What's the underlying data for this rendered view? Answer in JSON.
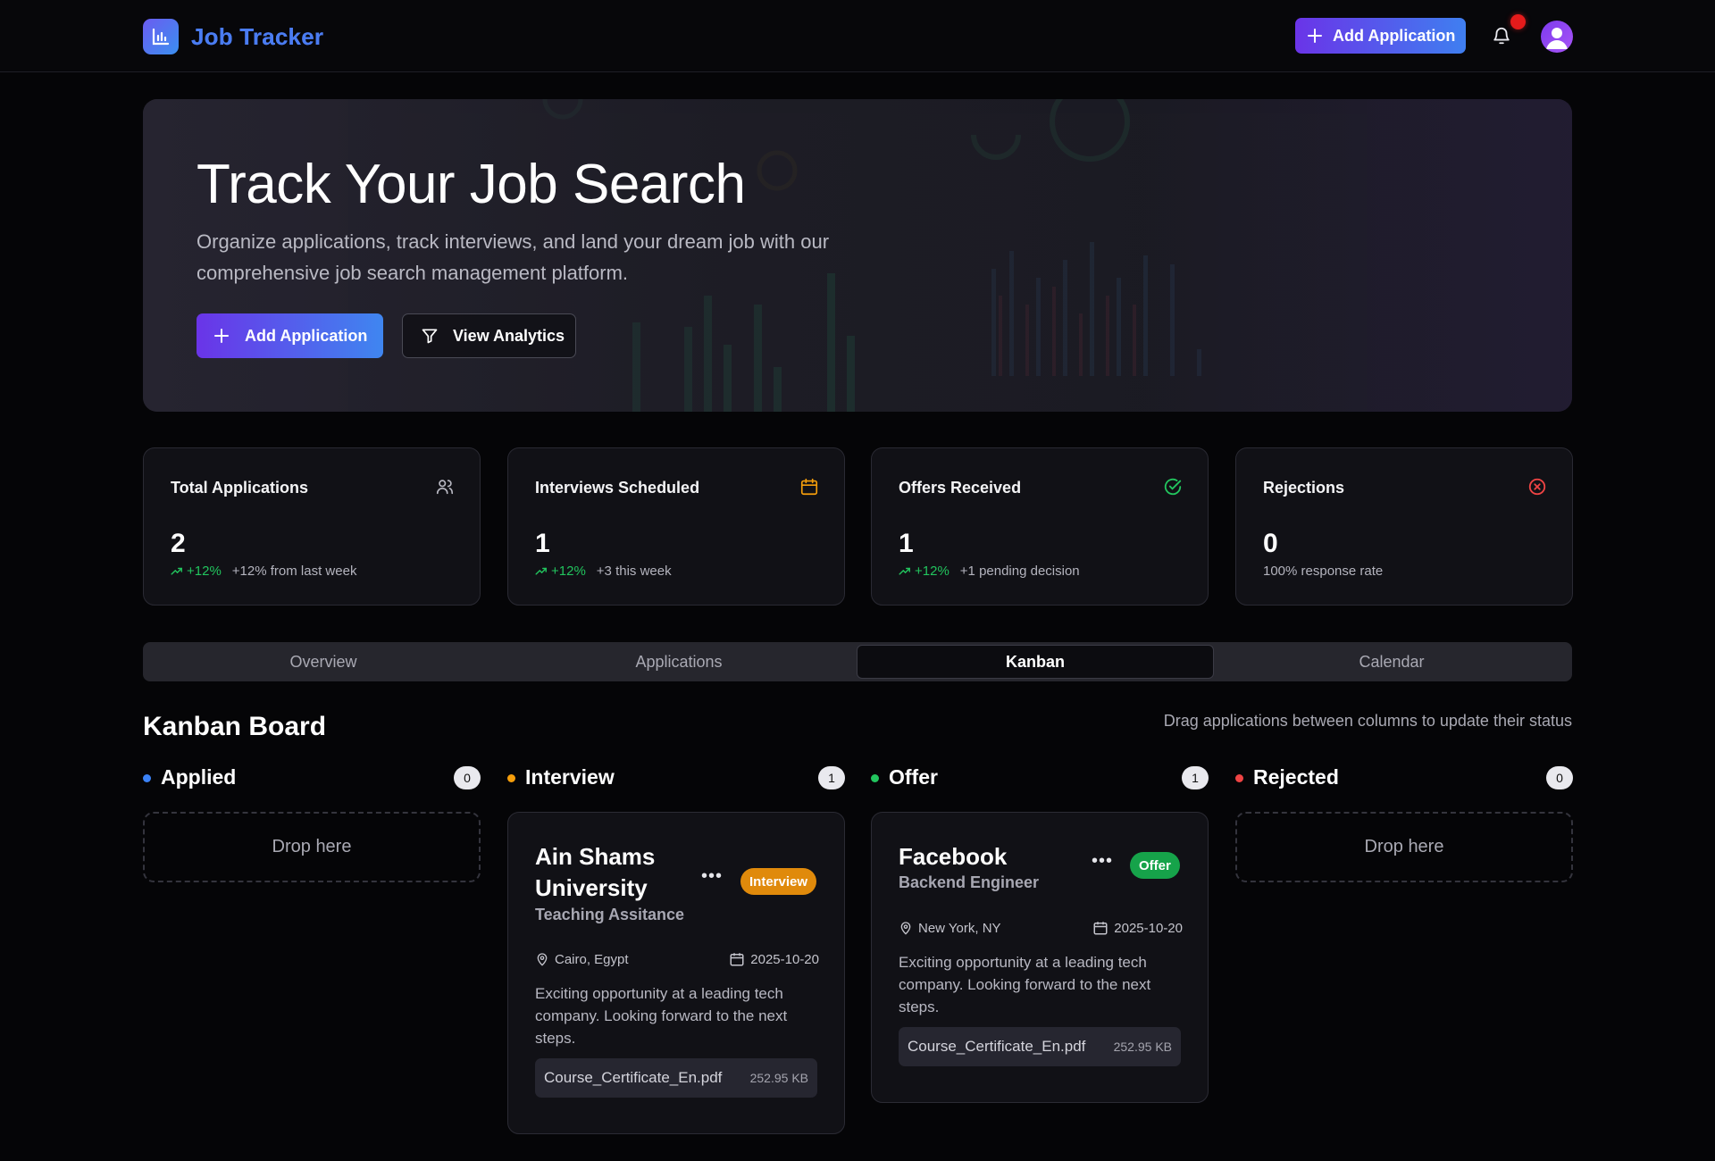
{
  "header": {
    "app_name": "Job Tracker",
    "add_button": "Add Application",
    "notification_icon": "bell-icon",
    "avatar_icon": "user-icon"
  },
  "hero": {
    "title": "Track Your Job Search",
    "subtitle": "Organize applications, track interviews, and land your dream job with our comprehensive job search management platform.",
    "add_button": "Add Application",
    "analytics_button": "View Analytics"
  },
  "stats": [
    {
      "title": "Total Applications",
      "value": "2",
      "trend": "+12%",
      "note": "+12% from last week",
      "icon": "users-icon",
      "icon_color": "#b8b8c2"
    },
    {
      "title": "Interviews Scheduled",
      "value": "1",
      "trend": "+12%",
      "note": "+3 this week",
      "icon": "calendar-icon",
      "icon_color": "#f59e0b"
    },
    {
      "title": "Offers Received",
      "value": "1",
      "trend": "+12%",
      "note": "+1 pending decision",
      "icon": "check-circle-icon",
      "icon_color": "#22c55e"
    },
    {
      "title": "Rejections",
      "value": "0",
      "trend": "",
      "note": "100% response rate",
      "icon": "x-circle-icon",
      "icon_color": "#ef4444"
    }
  ],
  "tabs": [
    "Overview",
    "Applications",
    "Kanban",
    "Calendar"
  ],
  "active_tab": "Kanban",
  "kanban": {
    "title": "Kanban Board",
    "hint": "Drag applications between columns to update their status",
    "drop_label": "Drop here",
    "columns": [
      {
        "name": "Applied",
        "count": "0",
        "color": "#3b82f6"
      },
      {
        "name": "Interview",
        "count": "1",
        "color": "#f59e0b"
      },
      {
        "name": "Offer",
        "count": "1",
        "color": "#22c55e"
      },
      {
        "name": "Rejected",
        "count": "0",
        "color": "#ef4444"
      }
    ],
    "cards": {
      "interview": {
        "company_line1": "Ain Shams",
        "company_line2": "University",
        "role": "Teaching Assitance",
        "badge": "Interview",
        "badge_color": "#f59e0b",
        "location": "Cairo, Egypt",
        "date": "2025-10-20",
        "description": "Exciting opportunity at a leading tech company. Looking forward to the next steps.",
        "file_name": "Course_Certificate_En.pdf",
        "file_size": "252.95 KB"
      },
      "offer": {
        "company": "Facebook",
        "role": "Backend Engineer",
        "badge": "Offer",
        "badge_color": "#16a34a",
        "location": "New York, NY",
        "date": "2025-10-20",
        "description": "Exciting opportunity at a leading tech company. Looking forward to the next steps.",
        "file_name": "Course_Certificate_En.pdf",
        "file_size": "252.95 KB"
      }
    }
  }
}
